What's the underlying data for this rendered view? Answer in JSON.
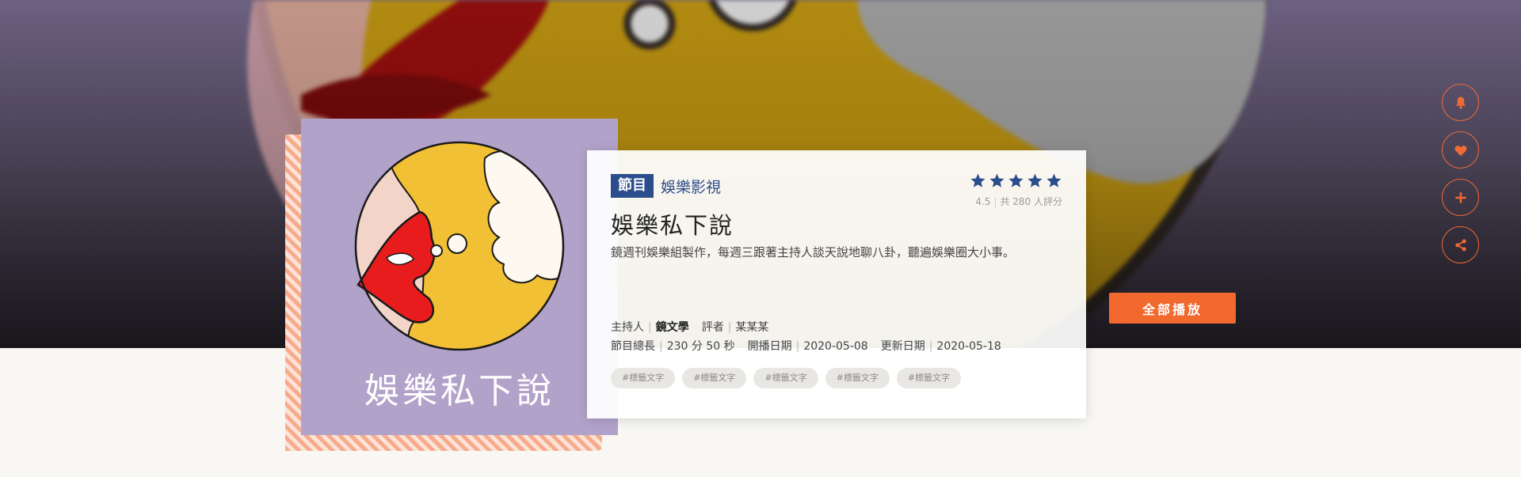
{
  "show": {
    "category_tag": "節目",
    "category_name": "娛樂影視",
    "title": "娛樂私下說",
    "cover_title": "娛樂私下說",
    "description": "鏡週刊娛樂組製作，每週三跟著主持人談天說地聊八卦，聽遍娛樂圈大小事。"
  },
  "rating": {
    "score": "4.5",
    "star_count": 5,
    "count_text": "共 280 人評分",
    "star_color": "#2c4d8c"
  },
  "meta": {
    "host_label": "主持人",
    "host_value": "鏡文學",
    "reviewer_label": "評者",
    "reviewer_value": "某某某",
    "duration_label": "節目總長",
    "duration_value": "230 分 50 秒",
    "start_label": "開播日期",
    "start_value": "2020-05-08",
    "update_label": "更新日期",
    "update_value": "2020-05-18"
  },
  "tags": [
    "#標籤文字",
    "#標籤文字",
    "#標籤文字",
    "#標籤文字",
    "#標籤文字"
  ],
  "actions": {
    "play_all_label": "全部播放",
    "side": [
      {
        "icon": "bell-icon"
      },
      {
        "icon": "heart-icon"
      },
      {
        "icon": "plus-icon"
      },
      {
        "icon": "share-icon"
      }
    ]
  },
  "colors": {
    "accent": "#f2692e",
    "brand": "#2c4d8c",
    "cover_bg": "#b1a2c9"
  }
}
